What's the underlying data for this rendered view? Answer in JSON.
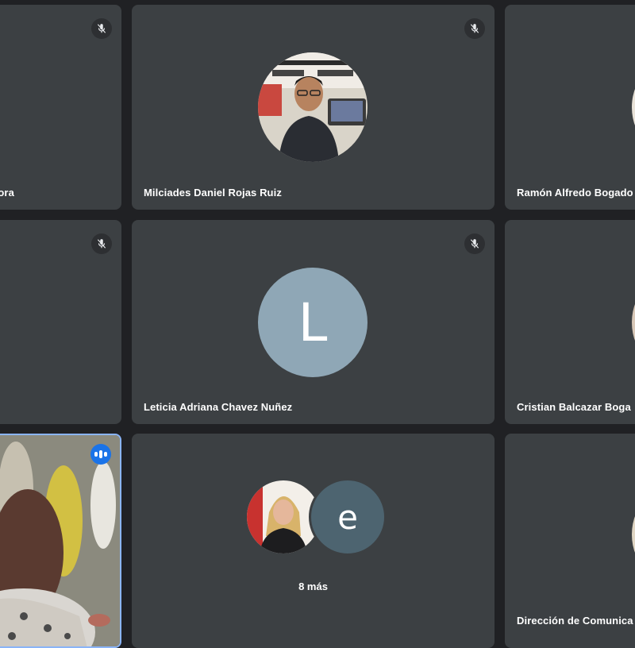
{
  "participants": [
    {
      "id": "r1c1",
      "name": "adora",
      "muted": true
    },
    {
      "id": "r1c2",
      "name": "Milciades Daniel Rojas Ruiz",
      "muted": true,
      "avatar_type": "photo"
    },
    {
      "id": "r1c3",
      "name": "Ramón Alfredo Bogado",
      "muted": false,
      "avatar_type": "photo"
    },
    {
      "id": "r2c1",
      "name": "",
      "muted": true
    },
    {
      "id": "r2c2",
      "name": "Leticia Adriana Chavez Nuñez",
      "muted": true,
      "avatar_type": "letter",
      "avatar_letter": "L",
      "avatar_color": "#8fa7b6"
    },
    {
      "id": "r2c3",
      "name": "Cristian Balcazar Boga",
      "muted": false,
      "avatar_type": "photo"
    },
    {
      "id": "r3c1",
      "name": "",
      "muted": false,
      "speaking": true,
      "avatar_type": "video"
    },
    {
      "id": "r3c3",
      "name": "Dirección de Comunica",
      "muted": false,
      "avatar_type": "photo"
    }
  ],
  "overflow_tile": {
    "more_label": "8 más",
    "avatars": [
      {
        "type": "photo"
      },
      {
        "type": "letter",
        "letter": "e",
        "color": "#4d6470"
      }
    ]
  },
  "colors": {
    "background": "#202124",
    "tile": "#3c4043",
    "speaking_accent": "#1a73e8",
    "active_border": "#8ab4f8"
  },
  "icons": {
    "muted": "mic-off-icon",
    "speaking": "speaking-indicator-icon"
  }
}
